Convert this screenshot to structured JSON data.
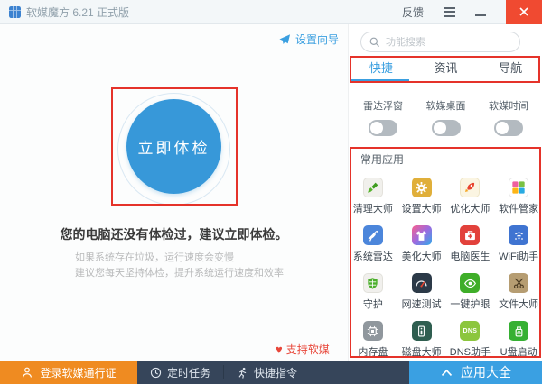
{
  "window": {
    "title": "软媒魔方 6.21 正式版",
    "feedback_label": "反馈"
  },
  "colors": {
    "accent_blue": "#3a9fe0",
    "check_circle_blue": "#3798d9",
    "close_button_red": "#f04a31",
    "annotation_red": "#e5332a",
    "login_orange": "#ef8b21",
    "bottombar_navy": "#36455a",
    "apps_all_blue": "#3aa0e2",
    "support_red": "#e8473a"
  },
  "left_panel": {
    "setup_wizard_label": "设置向导",
    "check_button_label": "立即体检",
    "headline": "您的电脑还没有体检过，建议立即体检。",
    "subline1": "如果系统存在垃圾，运行速度会变慢",
    "subline2": "建议您每天坚持体检，提升系统运行速度和效率",
    "support_label": "支持软媒"
  },
  "right_panel": {
    "search_placeholder": "功能搜索",
    "tabs": [
      {
        "label": "快捷",
        "active": true
      },
      {
        "label": "资讯",
        "active": false
      },
      {
        "label": "导航",
        "active": false
      }
    ],
    "toggles": [
      {
        "label": "雷达浮窗",
        "state": "off"
      },
      {
        "label": "软媒桌面",
        "state": "off"
      },
      {
        "label": "软媒时间",
        "state": "off"
      }
    ],
    "apps_header": "常用应用",
    "apps": [
      {
        "label": "清理大师",
        "icon": "brush-icon"
      },
      {
        "label": "设置大师",
        "icon": "gear-icon"
      },
      {
        "label": "优化大师",
        "icon": "rocket-icon"
      },
      {
        "label": "软件管家",
        "icon": "pinwheel-icon"
      },
      {
        "label": "系统雷达",
        "icon": "satellite-dish-icon"
      },
      {
        "label": "美化大师",
        "icon": "tshirt-icon"
      },
      {
        "label": "电脑医生",
        "icon": "first-aid-kit-icon"
      },
      {
        "label": "WiFi助手",
        "icon": "wifi-icon"
      },
      {
        "label": "守护",
        "icon": "shield-icon"
      },
      {
        "label": "网速测试",
        "icon": "speedometer-icon"
      },
      {
        "label": "一键护眼",
        "icon": "eye-icon"
      },
      {
        "label": "文件大师",
        "icon": "scissors-icon"
      },
      {
        "label": "内存盘",
        "icon": "chip-icon"
      },
      {
        "label": "磁盘大师",
        "icon": "disk-icon"
      },
      {
        "label": "DNS助手",
        "icon": "dns-icon",
        "icon_text": "DNS"
      },
      {
        "label": "U盘启动",
        "icon": "usb-icon"
      }
    ]
  },
  "bottom_bar": {
    "login_label": "登录软媒通行证",
    "scheduled_tasks_label": "定时任务",
    "quick_commands_label": "快捷指令",
    "apps_all_label": "应用大全"
  }
}
